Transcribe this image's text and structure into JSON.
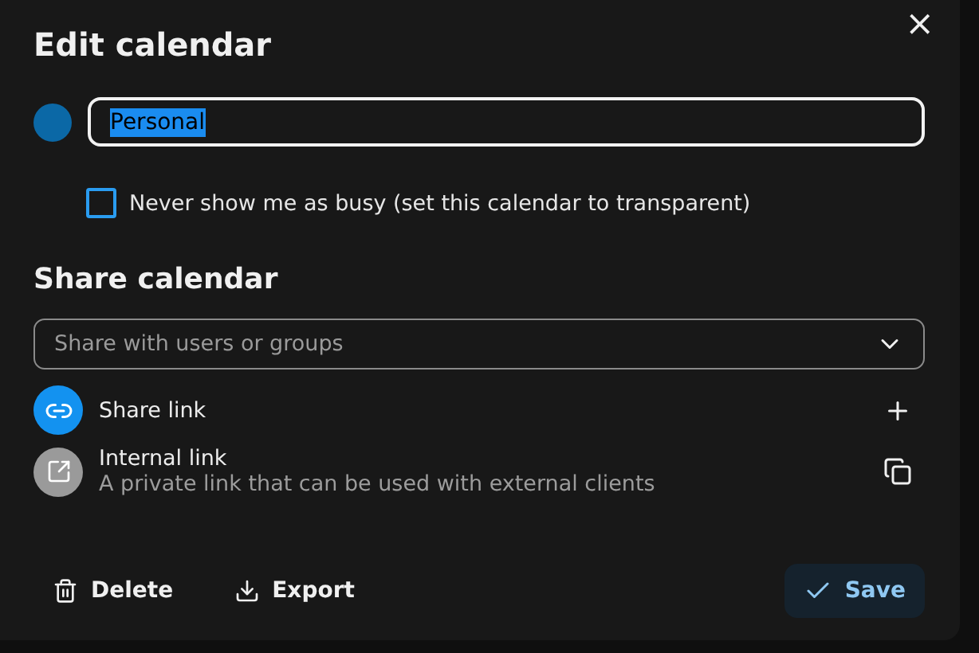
{
  "dialog": {
    "title": "Edit calendar",
    "close_label": "×"
  },
  "calendar": {
    "color": "#0b68a6",
    "name": {
      "value": "Personal",
      "text_selected": true
    }
  },
  "transparent_option": {
    "label": "Never show me as busy (set this calendar to transparent)",
    "checked": false
  },
  "share": {
    "heading": "Share calendar",
    "search": {
      "placeholder": "Share with users or groups"
    },
    "links": [
      {
        "kind": "share",
        "title": "Share link"
      },
      {
        "kind": "internal",
        "title": "Internal link",
        "subtitle": "A private link that can be used with external clients"
      }
    ]
  },
  "actions": [
    {
      "kind": "delete",
      "label": "Delete"
    },
    {
      "kind": "export",
      "label": "Export"
    },
    {
      "kind": "save",
      "label": "Save"
    }
  ]
}
